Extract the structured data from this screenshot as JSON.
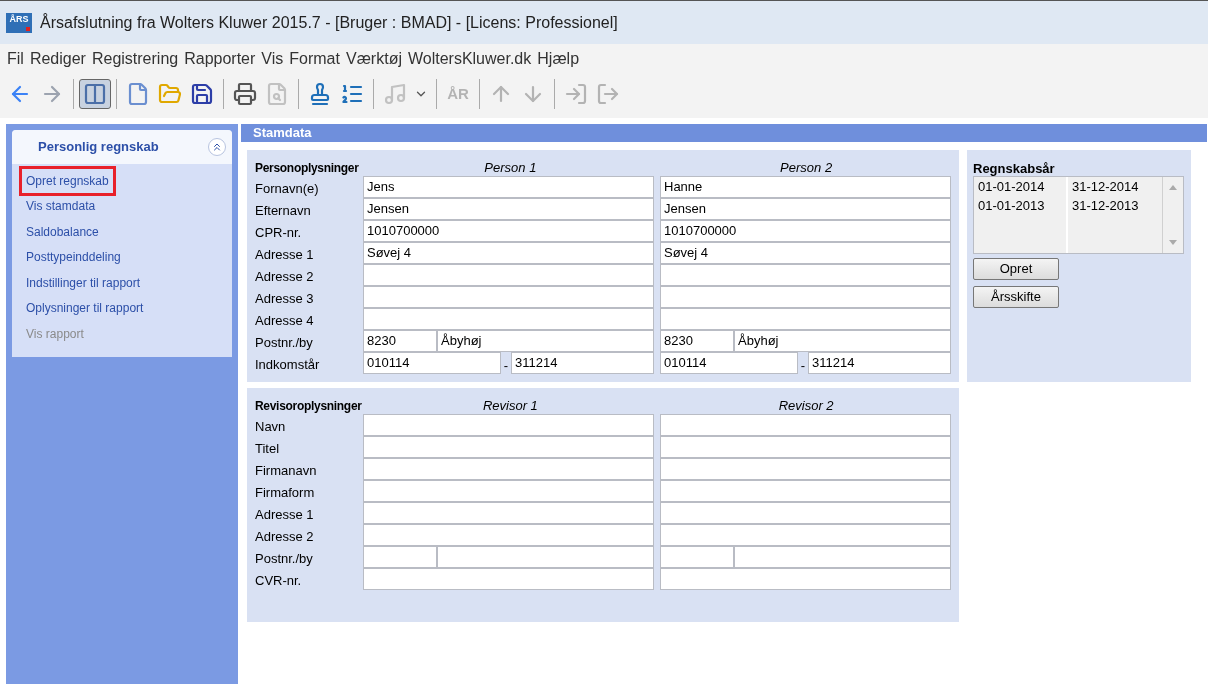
{
  "window": {
    "logo": "ÅRS",
    "title": "Årsafslutning fra Wolters Kluwer 2015.7 - [Bruger : BMAD] - [Licens: Professionel]"
  },
  "menu": [
    "Fil",
    "Rediger",
    "Registrering",
    "Rapporter",
    "Vis",
    "Format",
    "Værktøj",
    "WoltersKluwer.dk",
    "Hjælp"
  ],
  "toolbar": [
    [
      {
        "pressed": false,
        "disabled": false
      },
      {
        "pressed": false,
        "disabled": false
      }
    ],
    [
      {
        "pressed": true,
        "disabled": false
      }
    ],
    [
      {
        "pressed": false,
        "disabled": false
      },
      {
        "pressed": false,
        "disabled": false
      },
      {
        "pressed": false,
        "disabled": false
      }
    ],
    [
      {
        "pressed": false,
        "disabled": false
      },
      {
        "pressed": false,
        "disabled": true
      }
    ],
    [
      {
        "pressed": false,
        "disabled": false
      },
      {
        "pressed": false,
        "disabled": false
      }
    ],
    [
      {
        "pressed": false,
        "disabled": true
      },
      {
        "pressed": false,
        "disabled": false
      }
    ],
    [
      {
        "pressed": false,
        "disabled": true,
        "text": "ÅR"
      }
    ],
    [
      {
        "pressed": false,
        "disabled": true
      },
      {
        "pressed": false,
        "disabled": true
      }
    ],
    [
      {
        "pressed": false,
        "disabled": true
      },
      {
        "pressed": false,
        "disabled": true
      }
    ]
  ],
  "sidebar": {
    "title": "Personlig regnskab",
    "expanded": true,
    "items": [
      {
        "label": "Opret regnskab",
        "selected": true,
        "disabled": false
      },
      {
        "label": "Vis stamdata",
        "selected": false,
        "disabled": false
      },
      {
        "label": "Saldobalance",
        "selected": false,
        "disabled": false
      },
      {
        "label": "Posttypeinddeling",
        "selected": false,
        "disabled": false
      },
      {
        "label": "Indstillinger til rapport",
        "selected": false,
        "disabled": false
      },
      {
        "label": "Oplysninger til rapport",
        "selected": false,
        "disabled": false
      },
      {
        "label": "Vis rapport",
        "selected": false,
        "disabled": true
      }
    ]
  },
  "header": "Stamdata",
  "sections": [
    {
      "title": "Personoplysninger",
      "columns": [
        "Person 1",
        "Person 2"
      ],
      "rows": [
        {
          "label": "Fornavn(e)",
          "kind": "single",
          "cells": [
            {
              "value": "Jens"
            },
            {
              "value": "Hanne"
            }
          ]
        },
        {
          "label": "Efternavn",
          "kind": "single",
          "cells": [
            {
              "value": "Jensen"
            },
            {
              "value": "Jensen"
            }
          ]
        },
        {
          "label": "CPR-nr.",
          "kind": "single",
          "cells": [
            {
              "value": "1010700000"
            },
            {
              "value": "1010700000"
            }
          ]
        },
        {
          "label": "Adresse 1",
          "kind": "single",
          "cells": [
            {
              "value": "Søvej 4"
            },
            {
              "value": "Søvej 4"
            }
          ]
        },
        {
          "label": "Adresse 2",
          "kind": "single",
          "cells": [
            {},
            {}
          ]
        },
        {
          "label": "Adresse 3",
          "kind": "single",
          "cells": [
            {},
            {}
          ]
        },
        {
          "label": "Adresse 4",
          "kind": "single",
          "cells": [
            {},
            {}
          ]
        },
        {
          "label": "Postnr./by",
          "kind": "split",
          "cells": [
            {
              "postnr": "8230",
              "city": "Åbyhøj"
            },
            {
              "postnr": "8230",
              "city": "Åbyhøj"
            }
          ]
        },
        {
          "label": "Indkomstår",
          "kind": "range",
          "cells": [
            {
              "from": "010114",
              "separator": "-",
              "to": "311214"
            },
            {
              "from": "010114",
              "separator": "-",
              "to": "311214"
            }
          ]
        }
      ]
    },
    {
      "title": "Revisoroplysninger",
      "columns": [
        "Revisor 1",
        "Revisor 2"
      ],
      "rows": [
        {
          "label": "Navn",
          "kind": "single",
          "cells": [
            {},
            {}
          ]
        },
        {
          "label": "Titel",
          "kind": "single",
          "cells": [
            {},
            {}
          ]
        },
        {
          "label": "Firmanavn",
          "kind": "single",
          "cells": [
            {},
            {}
          ]
        },
        {
          "label": "Firmaform",
          "kind": "single",
          "cells": [
            {},
            {}
          ]
        },
        {
          "label": "Adresse 1",
          "kind": "single",
          "cells": [
            {},
            {}
          ]
        },
        {
          "label": "Adresse 2",
          "kind": "single",
          "cells": [
            {},
            {}
          ]
        },
        {
          "label": "Postnr./by",
          "kind": "split",
          "cells": [
            {},
            {}
          ]
        },
        {
          "label": "CVR-nr.",
          "kind": "single",
          "cells": [
            {},
            {}
          ]
        }
      ]
    }
  ],
  "fiscal_years": {
    "title": "Regnskabsår",
    "rows": [
      {
        "start": "01-01-2014",
        "end": "31-12-2014"
      },
      {
        "start": "01-01-2013",
        "end": "31-12-2013"
      }
    ],
    "buttons": [
      "Opret",
      "Årsskifte"
    ]
  }
}
